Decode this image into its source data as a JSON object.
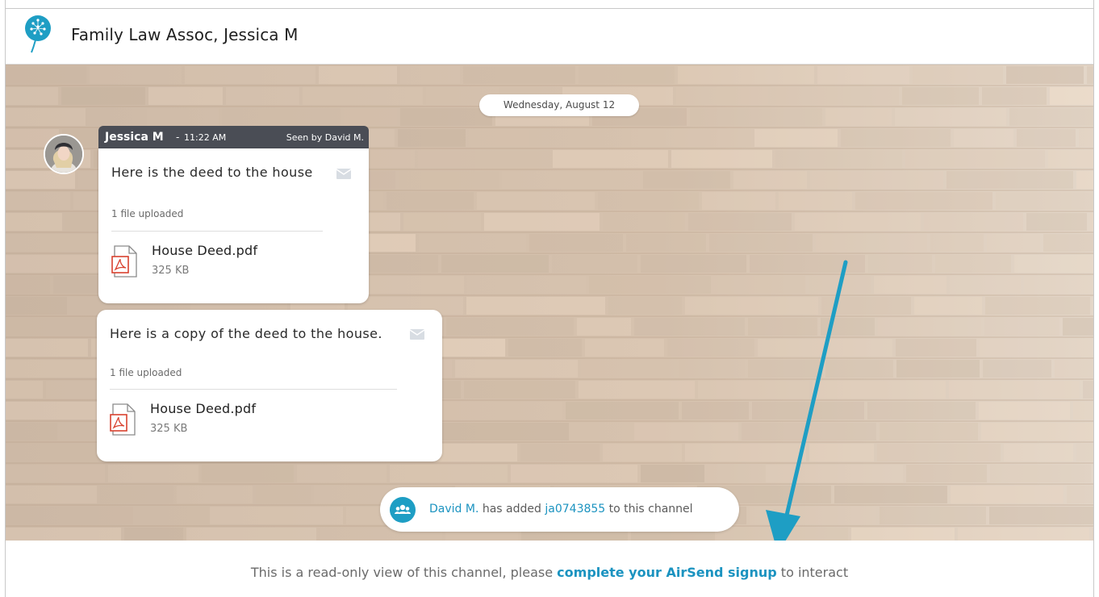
{
  "header": {
    "title": "Family Law Assoc, Jessica M"
  },
  "date_divider": "Wednesday, August 12",
  "message_group": {
    "sender": "Jessica M",
    "separator": "-",
    "time": "11:22 AM",
    "seen_by": "Seen by David M."
  },
  "messages": [
    {
      "text": "Here is the deed to the house",
      "upload_label": "1 file uploaded",
      "file": {
        "name": "House Deed.pdf",
        "size": "325 KB"
      }
    },
    {
      "text": "Here is a copy of the deed to the house.",
      "upload_label": "1 file uploaded",
      "file": {
        "name": "House Deed.pdf",
        "size": "325 KB"
      }
    }
  ],
  "system_notice": {
    "actor": "David M.",
    "middle": "has added",
    "target": "ja0743855",
    "suffix": "to this channel"
  },
  "footer": {
    "prefix": "This is a read-only view of this channel, please",
    "signup_link": "complete your AirSend signup",
    "suffix": "to interact"
  },
  "colors": {
    "accent": "#1b93c0",
    "header_bar": "#4a4d55",
    "pdf_red": "#d8412f",
    "arrow": "#1e9ec4"
  }
}
